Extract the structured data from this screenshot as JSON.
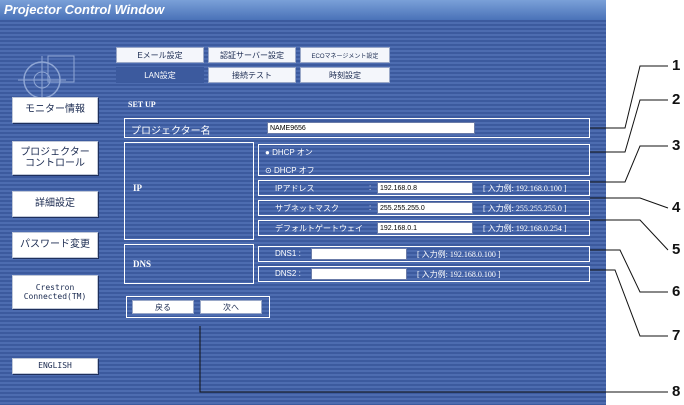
{
  "window": {
    "title": "Projector Control Window"
  },
  "sidebar": {
    "items": [
      {
        "label": "モニター情報"
      },
      {
        "label": "プロジェクター\nコントロール"
      },
      {
        "label": "詳細設定"
      },
      {
        "label": "パスワード変更"
      },
      {
        "label": "Crestron\nConnected(TM)"
      },
      {
        "label": "ENGLISH"
      }
    ]
  },
  "tabs": {
    "row1": [
      "Eメール設定",
      "認証サーバー設定",
      "ECOマネージメント設定"
    ],
    "row2": [
      "LAN設定",
      "接続テスト",
      "時刻設定"
    ],
    "active": "LAN設定"
  },
  "setup": {
    "title": "SET UP",
    "projector_name_label": "プロジェクター名",
    "projector_name_value": "NAME9656",
    "ip_label": "IP",
    "dhcp_on": "DHCP オン",
    "dhcp_off": "DHCP オフ",
    "ip_address_label": "IPアドレス",
    "ip_address_value": "192.168.0.8",
    "ip_address_example": "[ 入力例: 192.168.0.100 ]",
    "subnet_label": "サブネットマスク",
    "subnet_value": "255.255.255.0",
    "subnet_example": "[ 入力例: 255.255.255.0 ]",
    "gateway_label": "デフォルトゲートウェイ",
    "gateway_value": "192.168.0.1",
    "gateway_example": "[ 入力例: 192.168.0.254 ]",
    "dns_label": "DNS",
    "dns1_label": "DNS1 :",
    "dns1_value": "",
    "dns1_example": "[ 入力例: 192.168.0.100 ]",
    "dns2_label": "DNS2 :",
    "dns2_value": "",
    "dns2_example": "[ 入力例: 192.168.0.100 ]",
    "colon": ":"
  },
  "buttons": {
    "back": "戻る",
    "next": "次へ"
  },
  "callouts": [
    "1",
    "2",
    "3",
    "4",
    "5",
    "6",
    "7",
    "8"
  ]
}
